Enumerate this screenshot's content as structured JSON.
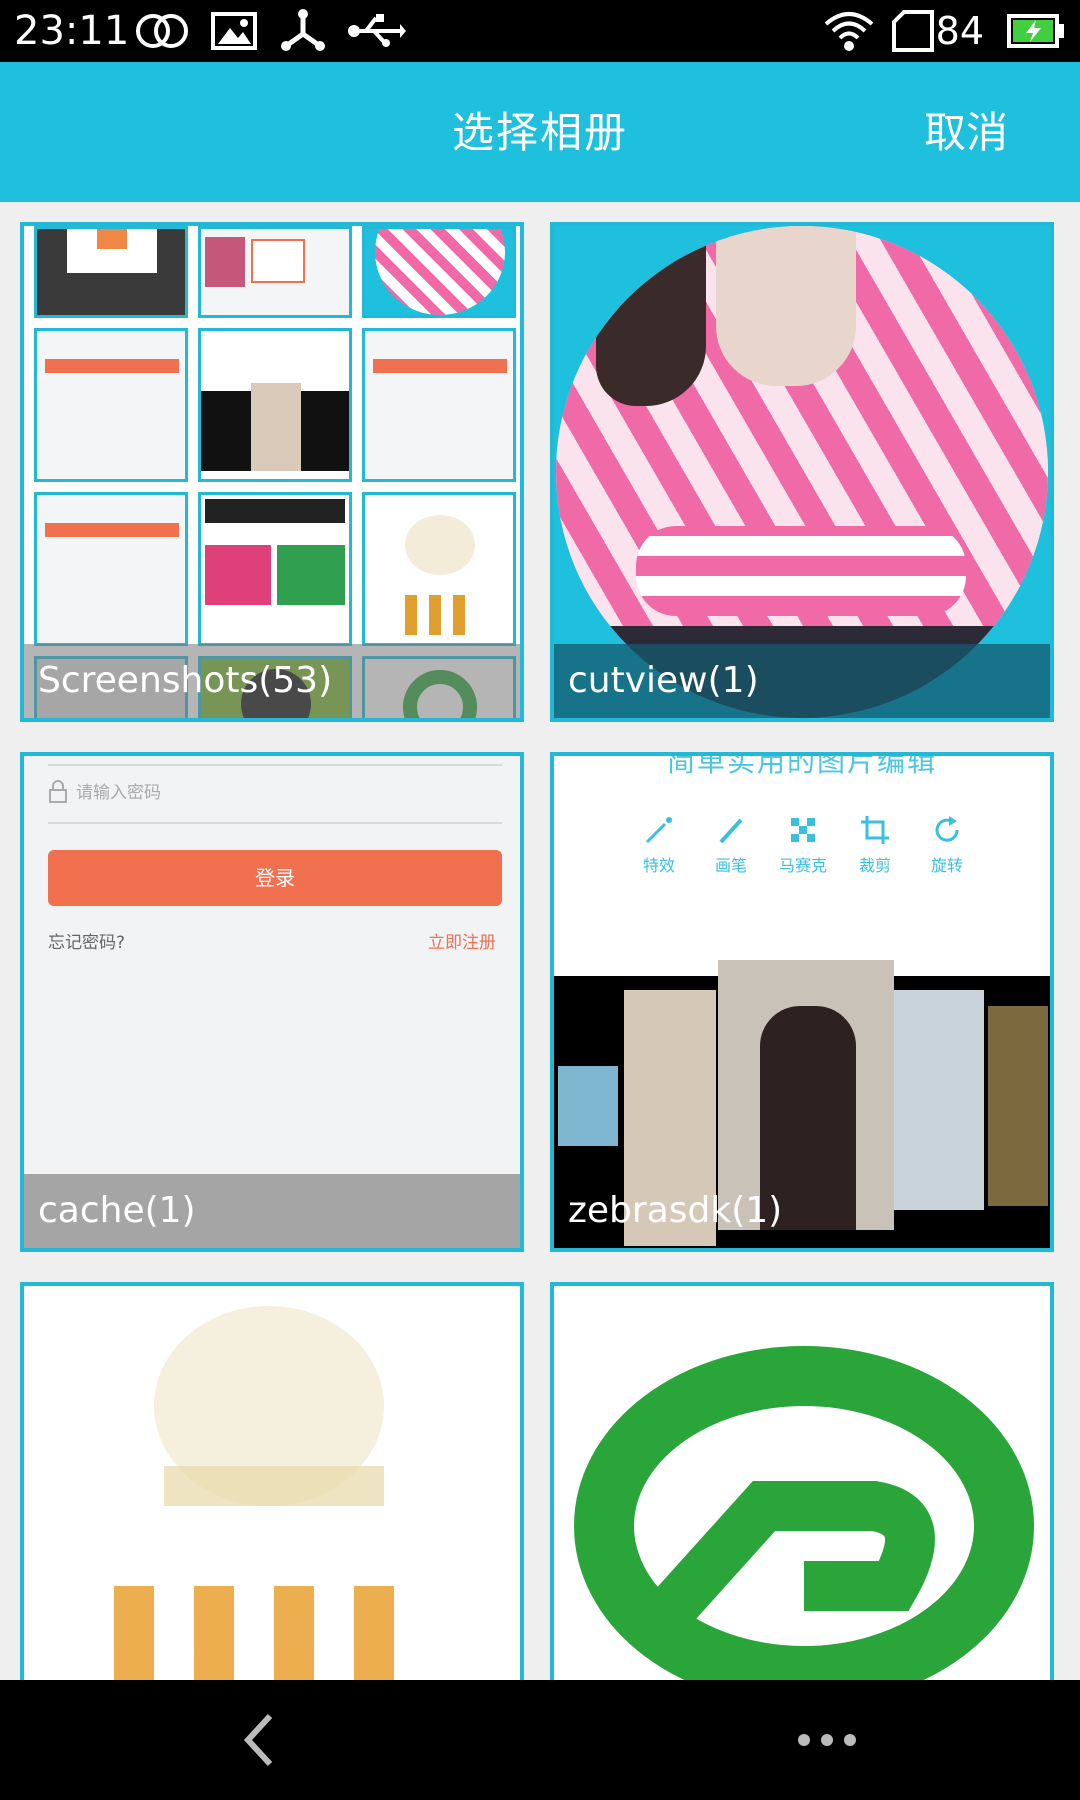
{
  "status_bar": {
    "time": "23:11",
    "battery": "84",
    "icons": [
      "dual-circles-icon",
      "image-icon",
      "share-icon",
      "usb-icon",
      "wifi-icon",
      "sim-icon",
      "battery-charging-icon"
    ]
  },
  "header": {
    "title": "选择相册",
    "cancel_label": "取消"
  },
  "albums": [
    {
      "name": "Screenshots(53)"
    },
    {
      "name": "cutview(1)"
    },
    {
      "name": "cache(1)"
    },
    {
      "name": "zebrasdk(1)"
    },
    {
      "name": ""
    },
    {
      "name": ""
    }
  ],
  "thumb_texts": {
    "password_placeholder": "请输入密码",
    "login_button": "登录",
    "forgot_password": "忘记密码?",
    "register_now": "立即注册",
    "editor_title": "简单实用的图片编辑",
    "tools": [
      "特效",
      "画笔",
      "马赛克",
      "裁剪",
      "旋转"
    ]
  },
  "colors": {
    "accent": "#1ec0de",
    "border": "#21b9d6",
    "login_orange": "#f1704f",
    "logo_green": "#2aa53a"
  }
}
